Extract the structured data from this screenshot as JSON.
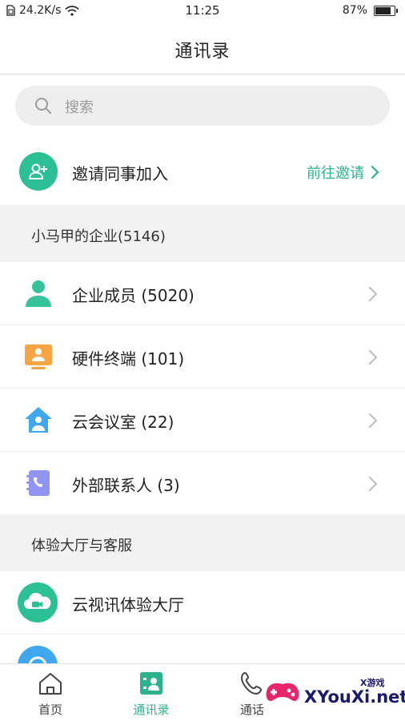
{
  "status_bar": {
    "network_speed": "24.2K/s",
    "time": "11:25",
    "battery": "87%",
    "battery_level": 0.87
  },
  "header": {
    "title": "通讯录"
  },
  "search": {
    "placeholder": "搜索"
  },
  "invite": {
    "label": "邀请同事加入",
    "link_label": "前往邀请",
    "icon": "add-person-icon"
  },
  "sections": [
    {
      "title": "小马甲的企业(5146)",
      "items": [
        {
          "label": "企业成员 (5020)",
          "icon": "person-icon",
          "color": "#35c39b"
        },
        {
          "label": "硬件终端 (101)",
          "icon": "terminal-icon",
          "color": "#f7a543"
        },
        {
          "label": "云会议室 (22)",
          "icon": "meeting-room-icon",
          "color": "#3ea7ee"
        },
        {
          "label": "外部联系人 (3)",
          "icon": "external-contact-icon",
          "color": "#8f95f0"
        }
      ]
    },
    {
      "title": "体验大厅与客服",
      "items": [
        {
          "label": "云视讯体验大厅",
          "icon": "cloud-video-icon",
          "color": "#2cc097"
        }
      ]
    }
  ],
  "bottom_nav": [
    {
      "label": "首页",
      "icon": "home-icon"
    },
    {
      "label": "通讯录",
      "icon": "contacts-icon",
      "active": true
    },
    {
      "label": "通话",
      "icon": "phone-icon"
    }
  ],
  "watermark": {
    "text": "XYouXi.net",
    "small": "X游戏"
  },
  "colors": {
    "accent": "#2cb38e",
    "section_bg": "#f2f2f2"
  }
}
